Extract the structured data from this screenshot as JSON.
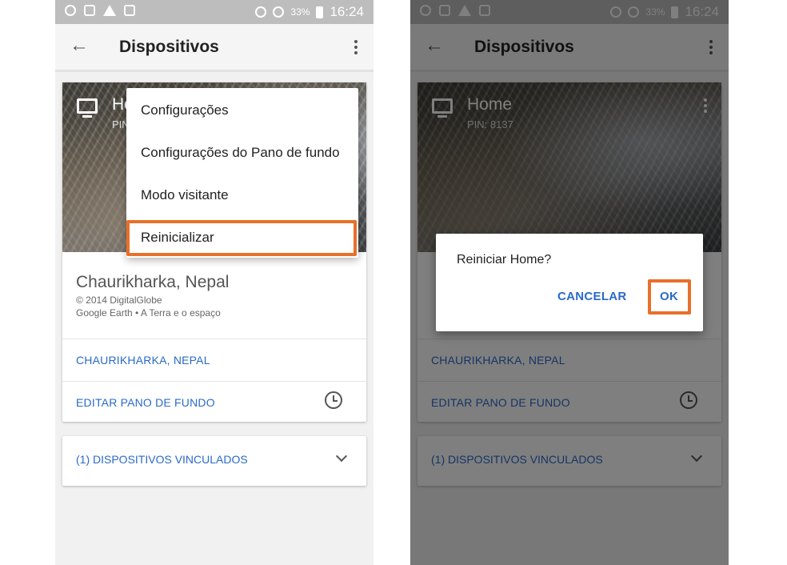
{
  "status_bar": {
    "battery": "33%",
    "time": "16:24"
  },
  "left": {
    "title": "Dispositivos",
    "device": {
      "name": "Home",
      "pin": "PIN: 8137"
    },
    "place": "Chaurikharka, Nepal",
    "credit_line1": "© 2014 DigitalGlobe",
    "credit_line2": "Google Earth • A Terra e o espaço",
    "place_link": "CHAURIKHARKA, NEPAL",
    "edit_link": "EDITAR PANO DE FUNDO",
    "linked_devices": "(1) DISPOSITIVOS VINCULADOS",
    "menu": {
      "items": [
        "Configurações",
        "Configurações do Pano de fundo",
        "Modo visitante",
        "Reinicializar"
      ]
    }
  },
  "right": {
    "title": "Dispositivos",
    "device": {
      "name": "Home",
      "pin": "PIN: 8137"
    },
    "place_link": "CHAURIKHARKA, NEPAL",
    "edit_link": "EDITAR PANO DE FUNDO",
    "linked_devices": "(1) DISPOSITIVOS VINCULADOS",
    "dialog": {
      "message": "Reiniciar Home?",
      "cancel": "CANCELAR",
      "ok": "OK"
    }
  },
  "colors": {
    "accent": "#2a6ac8",
    "highlight": "#e8702a"
  },
  "icons": [
    "back-arrow-icon",
    "more-vert-icon",
    "tv-icon",
    "history-icon",
    "chevron-down-icon"
  ]
}
